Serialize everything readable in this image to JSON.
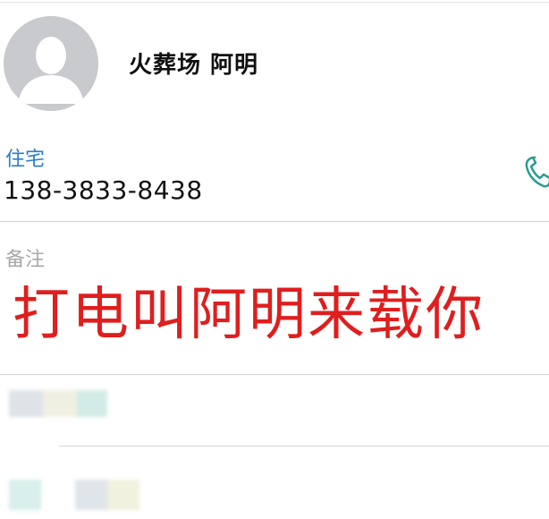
{
  "contact": {
    "name": "火葬场 阿明"
  },
  "phone": {
    "label": "住宅",
    "number": "138-3833-8438",
    "action_icon": "phone-icon"
  },
  "notes": {
    "label": "备注",
    "content": "打电叫阿明来载你"
  },
  "colors": {
    "accent": "#2a7cc7",
    "note_text": "#e01e1e",
    "label_gray": "#a9a9a9",
    "avatar_bg": "#c8cacd"
  }
}
